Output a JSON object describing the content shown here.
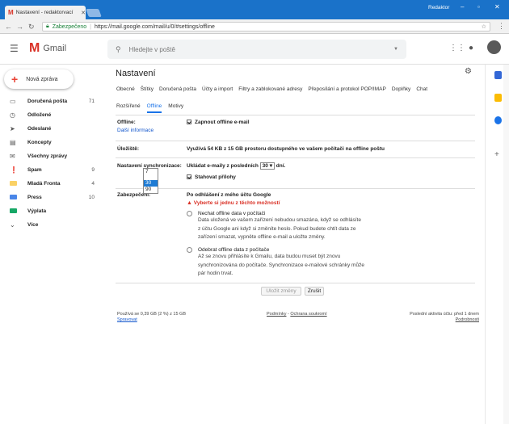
{
  "browser": {
    "tab_title": "Nastavení - redaktorvací",
    "user": "Redaktor",
    "secure": "Zabezpečeno",
    "url": "https://mail.google.com/mail/u/0/#settings/offline"
  },
  "header": {
    "app": "Gmail",
    "search_placeholder": "Hledejte v poště"
  },
  "sidebar": {
    "compose": "Nová zpráva",
    "items": [
      {
        "label": "Doručená pošta",
        "count": "71",
        "bold": true
      },
      {
        "label": "Odložené",
        "count": ""
      },
      {
        "label": "Odeslané",
        "count": ""
      },
      {
        "label": "Koncepty",
        "count": ""
      },
      {
        "label": "Všechny zprávy",
        "count": ""
      },
      {
        "label": "Spam",
        "count": "9",
        "bold": true
      },
      {
        "label": "Mladá Fronta",
        "count": "4",
        "bold": true
      },
      {
        "label": "Press",
        "count": "10",
        "bold": true
      },
      {
        "label": "Výplata",
        "count": ""
      },
      {
        "label": "Více",
        "count": ""
      }
    ]
  },
  "settings": {
    "title": "Nastavení",
    "tabs_row1": [
      "Obecné",
      "Štítky",
      "Doručená pošta",
      "Účty a import",
      "Filtry a zablokované adresy",
      "Přeposílání a protokol POP/IMAP",
      "Doplňky",
      "Chat"
    ],
    "tabs_row2": [
      "Rozšířené",
      "Offline",
      "Motivy"
    ],
    "active_tab": "Offline",
    "offline": {
      "label": "Offline:",
      "link": "Další informace",
      "checkbox": "Zapnout offline e-mail"
    },
    "storage": {
      "label": "Úložiště:",
      "text": "Využívá 54 KB z 15 GB prostoru dostupného ve vašem počítači na offline poštu"
    },
    "sync": {
      "label": "Nastavení synchronizace:",
      "prefix": "Ukládat e-maily z posledních",
      "value": "30",
      "suffix": "dní.",
      "options": [
        "7",
        "30",
        "90"
      ],
      "highlighted": "30",
      "attachments": "Stahovat přílohy"
    },
    "security": {
      "label": "Zabezpečení:",
      "heading": "Po odhlášení z mého účtu Google",
      "warning": "Vyberte si jednu z těchto možností",
      "opt1_title": "Nechat offline data v počítači",
      "opt1_lines": [
        "Data uložená ve vašem zařízení nebudou smazána, když se odhlásíte",
        "z účtu Google ani když si změníte heslo. Pokud budete chtít data ze",
        "zařízení smazat, vypněte offline e-mail a uložte změny."
      ],
      "opt2_title": "Odebrat offline data z počítače",
      "opt2_lines": [
        "Až se znovu přihlásíte k Gmailu, data budou muset být znovu",
        "synchronizována do počítače. Synchronizace e-mailové schránky může",
        "pár hodin trvat."
      ]
    },
    "save": "Uložit změny",
    "cancel": "Zrušit"
  },
  "footer": {
    "usage": "Používá se 0,39 GB (2 %) z 15 GB",
    "manage": "Spravovat",
    "terms": "Podmínky",
    "sep": " - ",
    "privacy": "Ochrana soukromí",
    "activity": "Poslední aktivita účtu: před 1 dnem",
    "details": "Podrobnosti"
  }
}
